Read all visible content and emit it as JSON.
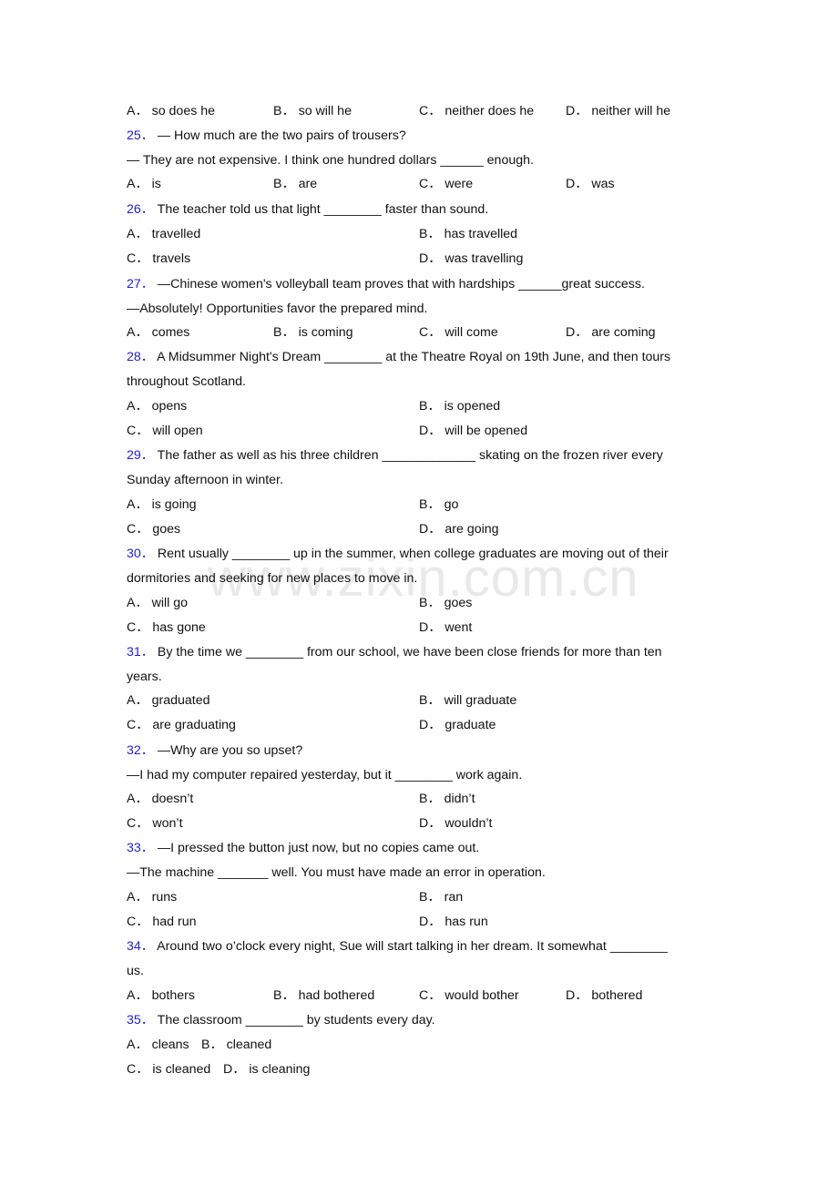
{
  "watermark": "www.zixin.com.cn",
  "colors": {
    "question_number": "#1f1fd6",
    "text": "#111111",
    "watermark": "#e9e9e9"
  },
  "q24": {
    "options": [
      {
        "letter": "A．",
        "text": "so does he"
      },
      {
        "letter": "B．",
        "text": "so will he"
      },
      {
        "letter": "C．",
        "text": "neither does he"
      },
      {
        "letter": "D．",
        "text": "neither will he"
      }
    ]
  },
  "questions": [
    {
      "number": "25．",
      "lines": [
        "— How much are the two pairs of trousers?",
        "— They are not expensive. I think one hundred dollars ______ enough."
      ],
      "options": [
        {
          "letter": "A．",
          "text": "is"
        },
        {
          "letter": "B．",
          "text": "are"
        },
        {
          "letter": "C．",
          "text": "were"
        },
        {
          "letter": "D．",
          "text": "was"
        }
      ]
    },
    {
      "number": "26．",
      "lines": [
        "The teacher told us that light ________ faster than sound."
      ],
      "options": [
        {
          "letter": "A．",
          "text": "travelled"
        },
        {
          "letter": "B．",
          "text": "has travelled"
        },
        {
          "letter": "C．",
          "text": "travels"
        },
        {
          "letter": "D．",
          "text": "was travelling"
        }
      ]
    },
    {
      "number": "27．",
      "lines": [
        "—Chinese women's volleyball team proves that with hardships ______great success.",
        "—Absolutely! Opportunities favor the prepared mind."
      ],
      "options": [
        {
          "letter": "A．",
          "text": "comes"
        },
        {
          "letter": "B．",
          "text": "is coming"
        },
        {
          "letter": "C．",
          "text": "will come"
        },
        {
          "letter": "D．",
          "text": "are coming"
        }
      ]
    },
    {
      "number": "28．",
      "lines": [
        "A Midsummer Night's Dream ________ at the Theatre Royal on 19th June, and then tours",
        "throughout Scotland."
      ],
      "options": [
        {
          "letter": "A．",
          "text": "opens"
        },
        {
          "letter": "B．",
          "text": "is opened"
        },
        {
          "letter": "C．",
          "text": "will open"
        },
        {
          "letter": "D．",
          "text": "will be opened"
        }
      ]
    },
    {
      "number": "29．",
      "lines": [
        "The father as well as his three children _____________ skating on the frozen river every",
        "Sunday afternoon in winter."
      ],
      "options": [
        {
          "letter": "A．",
          "text": "is going"
        },
        {
          "letter": "B．",
          "text": "go"
        },
        {
          "letter": "C．",
          "text": "goes"
        },
        {
          "letter": "D．",
          "text": "are going"
        }
      ]
    },
    {
      "number": "30．",
      "lines": [
        "Rent usually ________ up in the summer, when college graduates are moving out of their",
        "dormitories and seeking for new places to move in."
      ],
      "options": [
        {
          "letter": "A．",
          "text": "will go"
        },
        {
          "letter": "B．",
          "text": "goes"
        },
        {
          "letter": "C．",
          "text": "has gone"
        },
        {
          "letter": "D．",
          "text": "went"
        }
      ]
    },
    {
      "number": "31．",
      "lines": [
        "By the time we ________ from our school, we have been close friends for more than ten",
        "years."
      ],
      "options": [
        {
          "letter": "A．",
          "text": "graduated"
        },
        {
          "letter": "B．",
          "text": "will graduate"
        },
        {
          "letter": "C．",
          "text": "are graduating"
        },
        {
          "letter": "D．",
          "text": "graduate"
        }
      ]
    },
    {
      "number": "32．",
      "lines": [
        "—Why are you so upset?",
        "—I had my computer repaired yesterday, but it ________ work again."
      ],
      "options": [
        {
          "letter": "A．",
          "text": "doesn’t"
        },
        {
          "letter": "B．",
          "text": "didn’t"
        },
        {
          "letter": "C．",
          "text": "won’t"
        },
        {
          "letter": "D．",
          "text": "wouldn’t"
        }
      ]
    },
    {
      "number": "33．",
      "lines": [
        "—I pressed the button just now, but no copies came out.",
        "—The machine _______ well. You must have made an error in operation."
      ],
      "options": [
        {
          "letter": "A．",
          "text": "runs"
        },
        {
          "letter": "B．",
          "text": "ran"
        },
        {
          "letter": "C．",
          "text": "had run"
        },
        {
          "letter": "D．",
          "text": "has run"
        }
      ]
    },
    {
      "number": "34．",
      "lines": [
        "Around two o’clock every night, Sue will start talking in her dream. It somewhat ________",
        "us."
      ],
      "options": [
        {
          "letter": "A．",
          "text": "bothers"
        },
        {
          "letter": "B．",
          "text": "had bothered"
        },
        {
          "letter": "C．",
          "text": "would bother"
        },
        {
          "letter": "D．",
          "text": "bothered"
        }
      ]
    },
    {
      "number": "35．",
      "lines": [
        "The classroom ________ by students every day."
      ],
      "options": [
        {
          "letter": "A．",
          "text": "cleans"
        },
        {
          "letter": "B．",
          "text": "cleaned"
        },
        {
          "letter": "C．",
          "text": "is cleaned"
        },
        {
          "letter": "D．",
          "text": "is cleaning"
        }
      ]
    }
  ]
}
